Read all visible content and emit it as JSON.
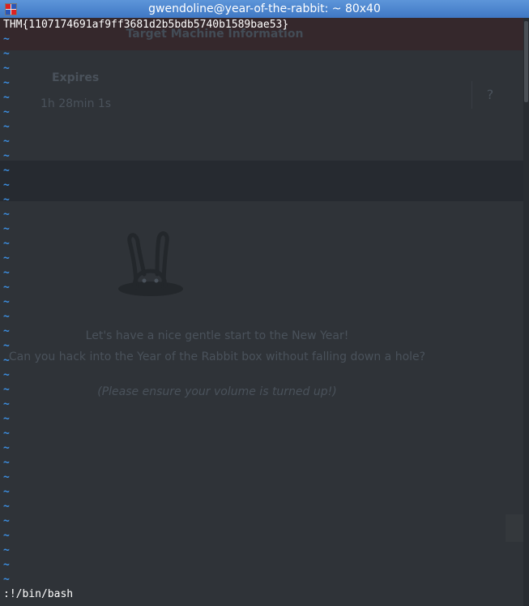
{
  "window": {
    "title": "gwendoline@year-of-the-rabbit: ~ 80x40"
  },
  "background_page": {
    "header_title": "Target Machine Information",
    "expires_label": "Expires",
    "expires_value": "1h 28min 1s",
    "help_glyph": "?",
    "intro_line_1": "Let's have a nice gentle start to the New Year!",
    "intro_line_2": "Can you hack into the Year of the Rabbit box without falling down a hole?",
    "intro_line_3": "(Please ensure your volume is turned up!)"
  },
  "terminal": {
    "flag_line": "THM{1107174691af9ff3681d2b5bdb5740b1589bae53}",
    "tilde": "~",
    "tilde_count": 38,
    "command_line": ":!/bin/bash"
  },
  "colors": {
    "titlebar": "#4a86cf",
    "terminal_bg": "#2f3338",
    "tilde": "#3c8ee0",
    "text": "#ffffff"
  },
  "icons": {
    "app_icon": "terminal-app-icon",
    "rabbit": "rabbit-in-hole-icon"
  }
}
